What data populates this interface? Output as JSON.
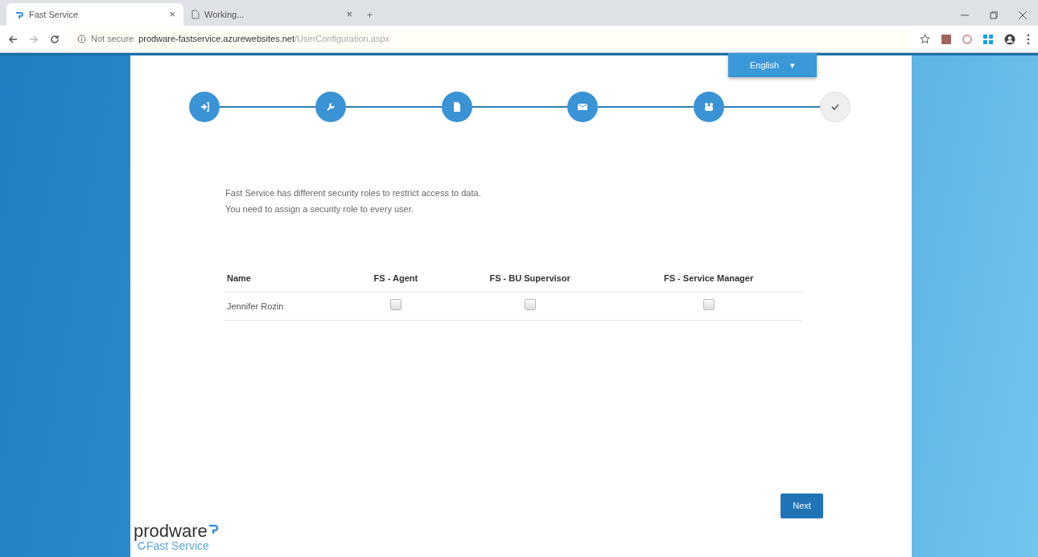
{
  "browser": {
    "tabs": [
      {
        "title": "Fast Service",
        "selected": true,
        "close": "×"
      },
      {
        "title": "Working...",
        "selected": false,
        "close": "×"
      }
    ],
    "new_tab": "+",
    "address": {
      "security": "Not secure",
      "host": "prodware-fastservice.azurewebsites.net",
      "path": "/UserConfiguration.aspx"
    }
  },
  "language": {
    "label": "English",
    "caret": "▾"
  },
  "steps": [
    {
      "kind": "login",
      "done": true
    },
    {
      "kind": "wrench",
      "done": true
    },
    {
      "kind": "document",
      "done": true
    },
    {
      "kind": "envelope",
      "done": true
    },
    {
      "kind": "users",
      "done": true
    },
    {
      "kind": "check",
      "done": false
    }
  ],
  "intro": [
    "Fast Service has different security roles to restrict access to data.",
    "You need to assign a security role to every user."
  ],
  "table": {
    "columns": [
      "Name",
      "FS - Agent",
      "FS - BU Supervisor",
      "FS - Service Manager"
    ],
    "rows": [
      {
        "name": "Jennifer Rozin",
        "roles": [
          {
            "checked": false
          },
          {
            "checked": false
          },
          {
            "checked": false
          }
        ]
      }
    ]
  },
  "next_button": "Next",
  "logo": {
    "brand": "prodware",
    "product": "Fast Service"
  }
}
